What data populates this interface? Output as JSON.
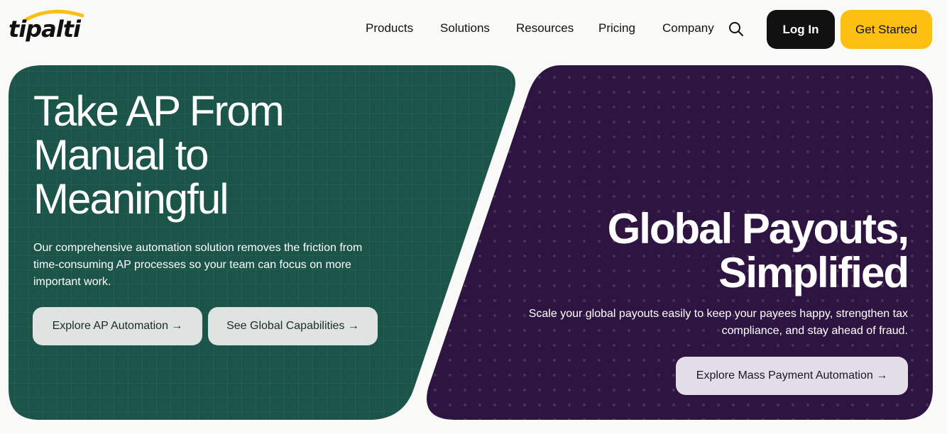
{
  "brand": {
    "logo_text": "tipalti",
    "accent": "#fdbf12"
  },
  "nav": {
    "items": [
      "Products",
      "Solutions",
      "Resources",
      "Pricing",
      "Company"
    ],
    "search_icon": "search-icon"
  },
  "header": {
    "login_label": "Log In",
    "cta_label": "Get Started"
  },
  "hero_left": {
    "title": "Take AP From Manual to Meaningful",
    "description": "Our comprehensive automation solution removes the friction from time-consuming AP processes so your team can focus on more important work.",
    "button_ap": "Explore AP Automation →",
    "button_global": "See Global Capabilities →",
    "bg_color": "#1b5449"
  },
  "hero_right": {
    "title": "Global Payouts, Simplified",
    "description": "Scale your global payouts easily to keep your payees happy, strengthen tax compliance, and stay ahead of fraud.",
    "button_mass": "Explore Mass Payment Automation →",
    "bg_color": "#2e1440"
  }
}
